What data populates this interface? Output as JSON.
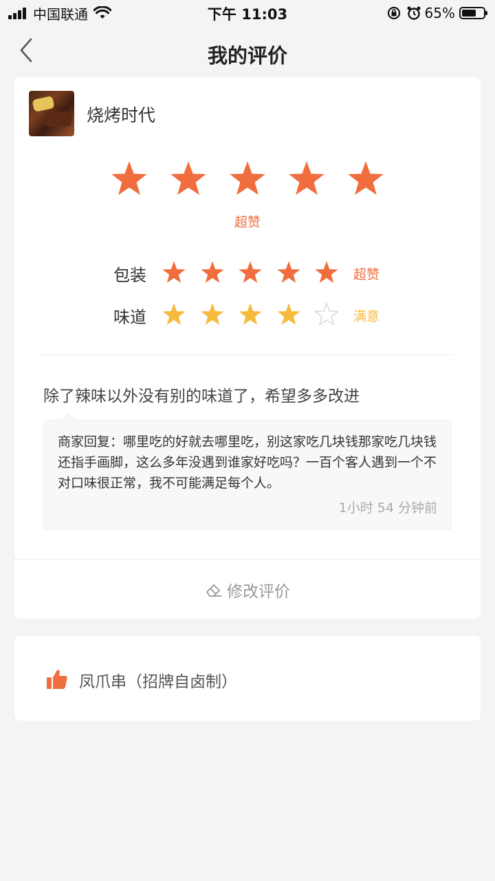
{
  "status_bar": {
    "carrier": "中国联通",
    "time": "下午 11:03",
    "battery": "65%",
    "battery_level": 0.65
  },
  "nav": {
    "title": "我的评价",
    "back_icon": "chevron-left-icon"
  },
  "review": {
    "shop_name": "烧烤时代",
    "overall": {
      "rating": 5,
      "max": 5,
      "label": "超赞"
    },
    "sub_ratings": [
      {
        "name": "包装",
        "rating": 5,
        "max": 5,
        "label": "超赞",
        "color": "#f06e3e"
      },
      {
        "name": "味道",
        "rating": 4,
        "max": 5,
        "label": "满意",
        "color": "#f6bb3e"
      }
    ],
    "comment": "除了辣味以外没有别的味道了，希望多多改进",
    "merchant_reply": {
      "text": "商家回复：哪里吃的好就去哪里吃，别这家吃几块钱那家吃几块钱还指手画脚，这么多年没遇到谁家好吃吗？一百个客人遇到一个不对口味很正常，我不可能满足每个人。",
      "time": "1小时 54 分钟前"
    },
    "edit_label": "修改评价",
    "edit_icon": "eraser-icon"
  },
  "liked_dish": {
    "icon": "thumbs-up-icon",
    "name": "凤爪串（招牌自卤制）"
  },
  "colors": {
    "accent": "#f06e3e",
    "star_yellow": "#f6bb3e",
    "empty_star": "#d8d8d8"
  }
}
